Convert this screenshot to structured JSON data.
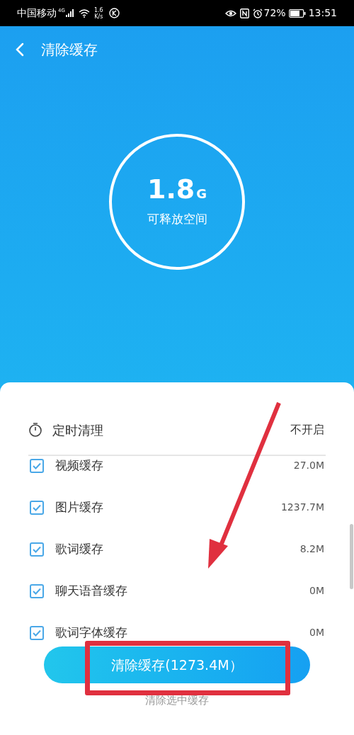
{
  "status_bar": {
    "carrier": "中国移动",
    "network": "4G",
    "speed_value": "1.6",
    "speed_unit": "K/s",
    "battery": "72%",
    "time": "13:51"
  },
  "header": {
    "title": "清除缓存"
  },
  "summary": {
    "amount": "1.8",
    "unit": "G",
    "caption": "可释放空间"
  },
  "schedule": {
    "label": "定时清理",
    "value": "不开启"
  },
  "items": [
    {
      "name": "视频缓存",
      "size": "27.0M",
      "checked": true
    },
    {
      "name": "图片缓存",
      "size": "1237.7M",
      "checked": true
    },
    {
      "name": "歌词缓存",
      "size": "8.2M",
      "checked": true
    },
    {
      "name": "聊天语音缓存",
      "size": "0M",
      "checked": true
    },
    {
      "name": "歌词字体缓存",
      "size": "0M",
      "checked": true
    }
  ],
  "clear_button": {
    "label": "清除缓存(1273.4M）"
  },
  "secondary_link": "清除选中缓存"
}
